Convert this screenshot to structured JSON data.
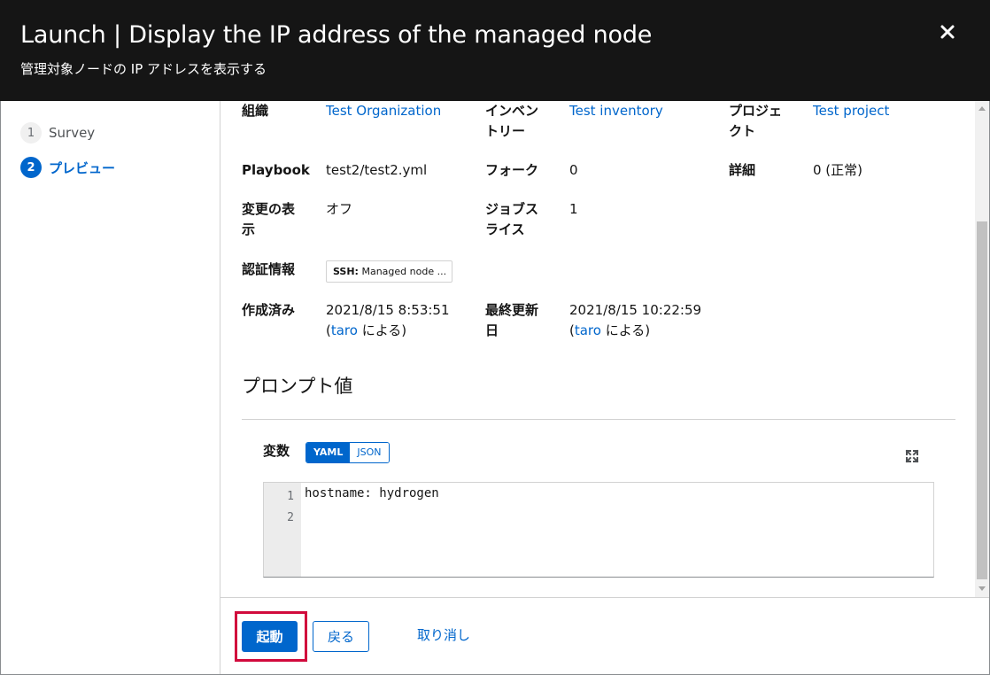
{
  "header": {
    "title": "Launch | Display the IP address of the managed node",
    "subtitle": "管理対象ノードの IP アドレスを表示する",
    "close_icon": "close-icon"
  },
  "nav": {
    "steps": [
      {
        "number": "1",
        "label": "Survey",
        "active": false
      },
      {
        "number": "2",
        "label": "プレビュー",
        "active": true
      }
    ]
  },
  "details": {
    "organization": {
      "label": "組織",
      "value": "Test Organization"
    },
    "inventory": {
      "label_line1": "インベン",
      "label_line2": "トリー",
      "value": "Test inventory"
    },
    "project": {
      "label_line1": "プロジェ",
      "label_line2": "クト",
      "value": "Test project"
    },
    "playbook": {
      "label": "Playbook",
      "value": "test2/test2.yml"
    },
    "forks": {
      "label": "フォーク",
      "value": "0"
    },
    "verbosity": {
      "label": "詳細",
      "value": "0 (正常)"
    },
    "show_changes": {
      "label_line1": "変更の表",
      "label_line2": "示",
      "value": "オフ"
    },
    "job_slicing": {
      "label_line1": "ジョブス",
      "label_line2": "ライス",
      "value": "1"
    },
    "credentials": {
      "label": "認証情報",
      "chip_type": "SSH:",
      "chip_name": "Managed node ..."
    },
    "created": {
      "label": "作成済み",
      "date": "2021/8/15 8:53:51",
      "by_open": "(",
      "user": "taro",
      "by_close": " による)"
    },
    "modified": {
      "label_line1": "最終更新",
      "label_line2": "日",
      "date": "2021/8/15 10:22:59",
      "by_open": "(",
      "user": "taro",
      "by_close": " による)"
    }
  },
  "prompt": {
    "section_title": "プロンプト値",
    "variables_label": "変数",
    "toggle": {
      "yaml": "YAML",
      "json": "JSON",
      "selected": "YAML"
    },
    "expand_icon": "expand-icon",
    "editor": {
      "line_numbers": [
        "1",
        "2"
      ],
      "lines": [
        "hostname: hydrogen",
        ""
      ]
    }
  },
  "footer": {
    "launch_label": "起動",
    "back_label": "戻る",
    "cancel_label": "取り消し"
  },
  "colors": {
    "header_bg": "#151515",
    "accent": "#0066cc",
    "highlight": "#d10a3c"
  }
}
